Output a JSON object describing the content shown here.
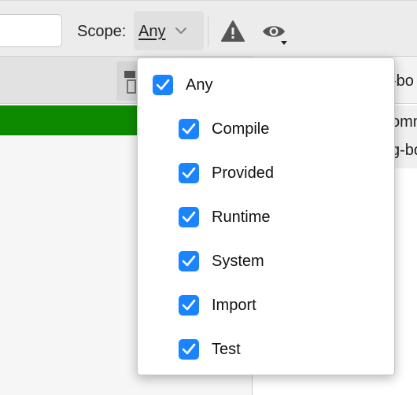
{
  "toolbar": {
    "scope_label": "Scope:",
    "scope_value": "Any",
    "icons": [
      "chevron-down-icon",
      "warning-icon",
      "eye-icon"
    ]
  },
  "right_panel": {
    "line1": "-bo",
    "line2": "omm",
    "line3": "g-bo"
  },
  "scope_menu": {
    "options": [
      {
        "label": "Any",
        "checked": true
      },
      {
        "label": "Compile",
        "checked": true
      },
      {
        "label": "Provided",
        "checked": true
      },
      {
        "label": "Runtime",
        "checked": true
      },
      {
        "label": "System",
        "checked": true
      },
      {
        "label": "Import",
        "checked": true
      },
      {
        "label": "Test",
        "checked": true
      }
    ]
  },
  "colors": {
    "checkbox": "#1a84ff",
    "progress": "#0e8a00"
  }
}
